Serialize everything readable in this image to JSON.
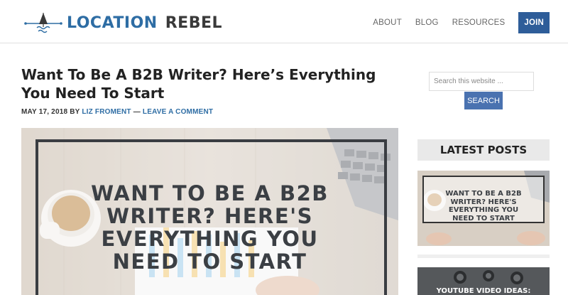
{
  "header": {
    "logo_word1": "LOCATION",
    "logo_word2": "REBEL",
    "nav": {
      "about": "ABOUT",
      "blog": "BLOG",
      "resources": "RESOURCES",
      "join": "JOIN"
    }
  },
  "post": {
    "title": "Want To Be A B2B Writer? Here’s Everything You Need To Start",
    "date": "MAY 17, 2018",
    "by": "BY",
    "author": "LIZ FROMENT",
    "dash": "—",
    "comment_link": "LEAVE A COMMENT",
    "feature_lines": [
      "WANT TO BE A B2B",
      "WRITER? HERE'S",
      "EVERYTHING YOU",
      "NEED TO START"
    ]
  },
  "sidebar": {
    "search_placeholder": "Search this website ...",
    "search_button": "SEARCH",
    "widget_title": "LATEST POSTS",
    "thumb1_lines": [
      "WANT TO BE A B2B",
      "WRITER? HERE'S",
      "EVERYTHING YOU",
      "NEED TO START"
    ],
    "thumb2_text": "YOUTUBE VIDEO IDEAS:"
  },
  "colors": {
    "brand_blue": "#2e6da4",
    "join_bg": "#2e5d99",
    "search_btn_bg": "#4a72b0"
  }
}
